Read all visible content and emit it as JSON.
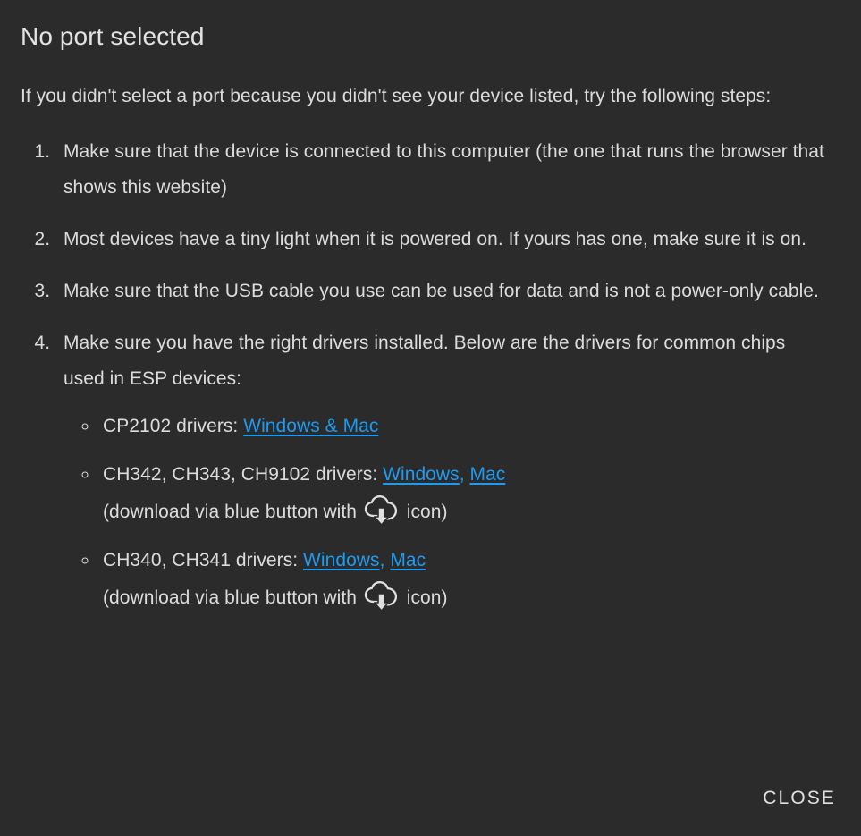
{
  "dialog": {
    "title": "No port selected",
    "intro": "If you didn't select a port because you didn't see your device listed, try the following steps:",
    "steps": [
      "Make sure that the device is connected to this computer (the one that runs the browser that shows this website)",
      "Most devices have a tiny light when it is powered on. If yours has one, make sure it is on.",
      "Make sure that the USB cable you use can be used for data and is not a power-only cable.",
      "Make sure you have the right drivers installed. Below are the drivers for common chips used in ESP devices:"
    ],
    "drivers": [
      {
        "label": "CP2102 drivers: ",
        "links": [
          {
            "text": "Windows & Mac"
          }
        ],
        "separator": "",
        "note": ""
      },
      {
        "label": "CH342, CH343, CH9102 drivers: ",
        "links": [
          {
            "text": "Windows"
          },
          {
            "text": "Mac"
          }
        ],
        "separator": ", ",
        "note_before": "(download via blue button with ",
        "note_icon": "cloud-download-icon",
        "note_after": " icon)"
      },
      {
        "label": "CH340, CH341 drivers: ",
        "links": [
          {
            "text": "Windows"
          },
          {
            "text": "Mac"
          }
        ],
        "separator": ", ",
        "note_before": "(download via blue button with ",
        "note_icon": "cloud-download-icon",
        "note_after": " icon)"
      }
    ],
    "actions": {
      "close_label": "Close"
    },
    "colors": {
      "background": "#2b2b2b",
      "text": "#dcdcdc",
      "link": "#1e9bf0",
      "title": "#e3e3e3"
    }
  }
}
